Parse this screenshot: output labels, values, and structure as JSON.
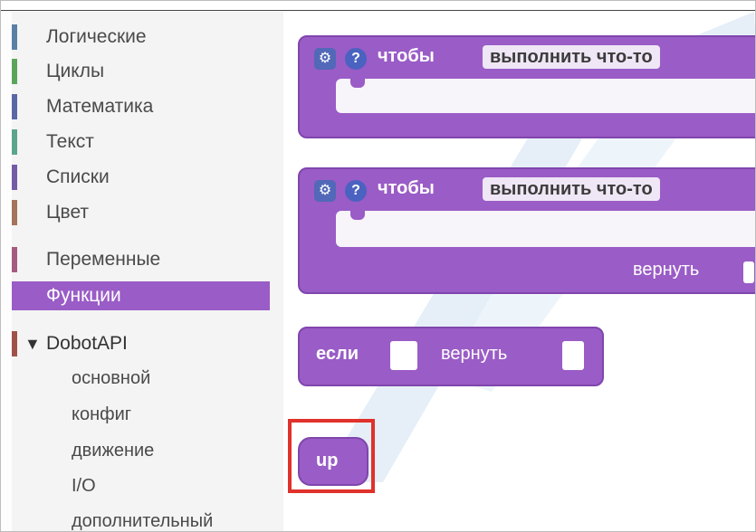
{
  "toolbox": {
    "categories": [
      {
        "label": "Логические",
        "color": "#5b80a5"
      },
      {
        "label": "Циклы",
        "color": "#5ba55b"
      },
      {
        "label": "Математика",
        "color": "#5b67a5"
      },
      {
        "label": "Текст",
        "color": "#5ba58c"
      },
      {
        "label": "Списки",
        "color": "#745ba5"
      },
      {
        "label": "Цвет",
        "color": "#a5745b"
      },
      {
        "label": "Переменные",
        "color": "#a55b80"
      },
      {
        "label": "Функции",
        "color": "#9a5cc6"
      }
    ],
    "selected": "Функции",
    "group": {
      "label": "DobotAPI",
      "toggle": "▼"
    },
    "subcategories": [
      "основной",
      "конфиг",
      "движение",
      "I/O",
      "дополнительный"
    ]
  },
  "workspace": {
    "block_to_do": {
      "gear_icon": "gear-icon",
      "help_icon": "help-icon",
      "keyword": "чтобы",
      "name": "выполнить что-то"
    },
    "block_to_do_return": {
      "gear_icon": "gear-icon",
      "help_icon": "help-icon",
      "keyword": "чтобы",
      "name": "выполнить что-то",
      "return_label": "вернуть"
    },
    "block_if_return": {
      "if_label": "если",
      "return_label": "вернуть"
    },
    "block_call": {
      "label": "up"
    }
  },
  "colors": {
    "procedure_block": "#9a5cc6",
    "selection_highlight": "#e0312b"
  }
}
